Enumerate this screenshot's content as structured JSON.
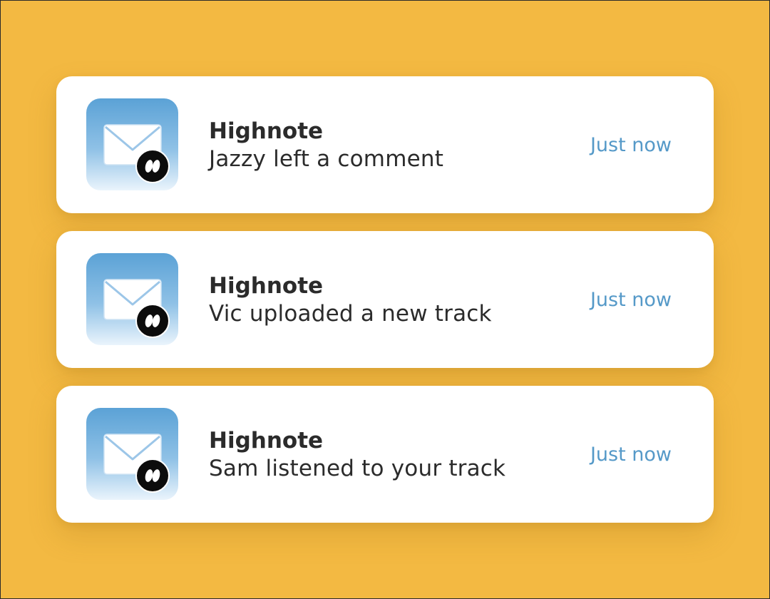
{
  "accent_time_color": "#5599C8",
  "background_color": "#F3B942",
  "notifications": [
    {
      "app_name": "Highnote",
      "message": "Jazzy left a comment",
      "time": "Just now",
      "icon": "mail-icon",
      "badge_icon": "highnote-logo-icon"
    },
    {
      "app_name": "Highnote",
      "message": "Vic uploaded a new track",
      "time": "Just now",
      "icon": "mail-icon",
      "badge_icon": "highnote-logo-icon"
    },
    {
      "app_name": "Highnote",
      "message": "Sam listened to your track",
      "time": "Just now",
      "icon": "mail-icon",
      "badge_icon": "highnote-logo-icon"
    }
  ]
}
